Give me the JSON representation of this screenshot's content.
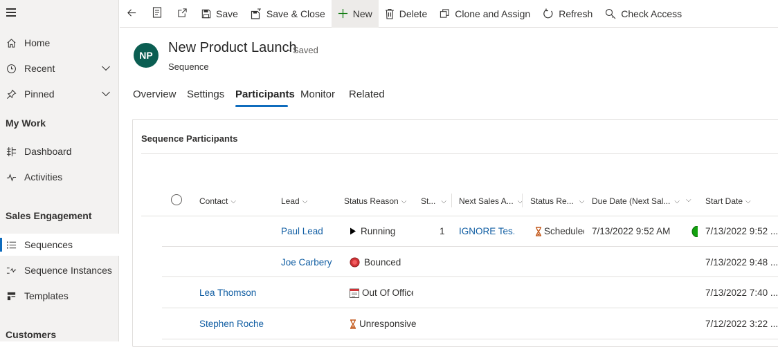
{
  "sidebar": {
    "items": [
      {
        "label": "Home"
      },
      {
        "label": "Recent"
      },
      {
        "label": "Pinned"
      }
    ],
    "my_work_header": "My Work",
    "my_work_items": [
      {
        "label": "Dashboard"
      },
      {
        "label": "Activities"
      }
    ],
    "sales_header": "Sales Engagement",
    "sales_items": [
      {
        "label": "Sequences"
      },
      {
        "label": "Sequence Instances"
      },
      {
        "label": "Templates"
      }
    ],
    "customers_header": "Customers"
  },
  "toolbar": {
    "save": "Save",
    "save_close": "Save & Close",
    "new": "New",
    "delete": "Delete",
    "clone_assign": "Clone and Assign",
    "refresh": "Refresh",
    "check_access": "Check Access"
  },
  "record": {
    "avatar": "NP",
    "title": "New Product Launch",
    "status": "- Saved",
    "type": "Sequence"
  },
  "tabs": [
    {
      "label": "Overview"
    },
    {
      "label": "Settings"
    },
    {
      "label": "Participants"
    },
    {
      "label": "Monitor"
    },
    {
      "label": "Related"
    }
  ],
  "section": {
    "title": "Sequence Participants"
  },
  "grid": {
    "columns": [
      {
        "label": "Contact"
      },
      {
        "label": "Lead"
      },
      {
        "label": "Status Reason"
      },
      {
        "label": "St..."
      },
      {
        "label": "Next Sales A..."
      },
      {
        "label": "Status Re..."
      },
      {
        "label": "Due Date (Next Sal..."
      },
      {
        "label": ""
      },
      {
        "label": "Start Date"
      }
    ],
    "rows": [
      {
        "contact": "",
        "lead": "Paul Lead",
        "status_reason": "Running",
        "step": "1",
        "next_sales": "IGNORE Tes...",
        "status_re": "Scheduled",
        "due_date": "7/13/2022 9:52 AM",
        "start_date": "7/13/2022 9:52 ..."
      },
      {
        "contact": "",
        "lead": "Joe Carbery",
        "status_reason": "Bounced",
        "step": "",
        "next_sales": "",
        "status_re": "",
        "due_date": "",
        "start_date": "7/13/2022 9:48 ..."
      },
      {
        "contact": "Lea Thomson",
        "lead": "",
        "status_reason": "Out Of Office",
        "step": "",
        "next_sales": "",
        "status_re": "",
        "due_date": "",
        "start_date": "7/13/2022 7:40 ..."
      },
      {
        "contact": "Stephen Roche",
        "lead": "",
        "status_reason": "Unresponsive",
        "step": "",
        "next_sales": "",
        "status_re": "",
        "due_date": "",
        "start_date": "7/12/2022 3:22 ..."
      }
    ]
  },
  "colors": {
    "accent": "#0f6cbd",
    "link": "#115ea3",
    "avatar_bg": "#0b5e52",
    "running_icon": "#000000",
    "bounced_icon": "#d13438",
    "progress_green": "#13a10e",
    "hourglass": "#c4591b"
  }
}
